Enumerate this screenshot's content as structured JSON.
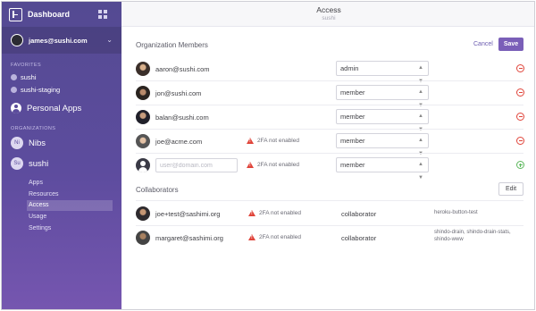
{
  "sidebar": {
    "brand": "Dashboard",
    "account": "james@sushi.com",
    "favorites_label": "FAVORITES",
    "favorites": [
      "sushi",
      "sushi-staging"
    ],
    "personal_apps": "Personal Apps",
    "organizations_label": "ORGANIZATIONS",
    "orgs": [
      {
        "badge": "Ni",
        "name": "Nibs"
      },
      {
        "badge": "Su",
        "name": "sushi"
      }
    ],
    "sub_items": [
      "Apps",
      "Resources",
      "Access",
      "Usage",
      "Settings"
    ],
    "active_sub": "Access"
  },
  "header": {
    "title": "Access",
    "subtitle": "sushi"
  },
  "members": {
    "title": "Organization Members",
    "cancel": "Cancel",
    "save": "Save",
    "rows": [
      {
        "email": "aaron@sushi.com",
        "role": "admin",
        "warning": ""
      },
      {
        "email": "jon@sushi.com",
        "role": "member",
        "warning": ""
      },
      {
        "email": "balan@sushi.com",
        "role": "member",
        "warning": ""
      },
      {
        "email": "joe@acme.com",
        "role": "member",
        "warning": "2FA not enabled"
      }
    ],
    "new_row": {
      "placeholder": "user@domain.com",
      "role": "member",
      "warning": "2FA not enabled"
    }
  },
  "collaborators": {
    "title": "Collaborators",
    "edit": "Edit",
    "rows": [
      {
        "name": "joe+test@sashimi.org",
        "warning": "2FA not enabled",
        "role": "collaborator",
        "apps": "heroku-button-test"
      },
      {
        "name": "margaret@sashimi.org",
        "warning": "2FA not enabled",
        "role": "collaborator",
        "apps": "shindo-drain, shindo-drain-stats, shindo-www"
      }
    ]
  },
  "colors": {
    "sidebar_top": "#544a92",
    "sidebar_bottom": "#7656b0",
    "accent": "#7a5fb8",
    "danger": "#e0443a",
    "success": "#5cb85c"
  }
}
